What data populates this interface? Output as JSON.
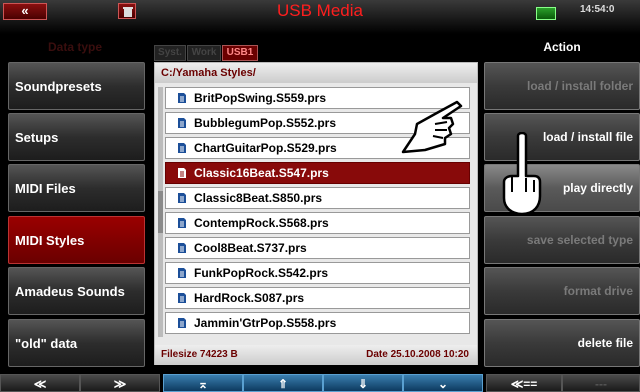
{
  "titlebar": {
    "back_label": "«",
    "title": "USB Media",
    "clock": "14:54:0"
  },
  "left": {
    "heading": "Data type",
    "items": [
      {
        "label": "Soundpresets",
        "active": false
      },
      {
        "label": "Setups",
        "active": false
      },
      {
        "label": "MIDI Files",
        "active": false
      },
      {
        "label": "MIDI Styles",
        "active": true
      },
      {
        "label": "Amadeus Sounds",
        "active": false
      },
      {
        "label": "\"old\" data",
        "active": false
      }
    ]
  },
  "tabs": [
    {
      "label": "Syst.",
      "active": false
    },
    {
      "label": "Work",
      "active": false
    },
    {
      "label": "USB1",
      "active": true
    }
  ],
  "browser": {
    "path": "C:/Yamaha Styles/",
    "files": [
      {
        "name": "BritPopSwing.S559.prs",
        "selected": false
      },
      {
        "name": "BubblegumPop.S552.prs",
        "selected": false
      },
      {
        "name": "ChartGuitarPop.S529.prs",
        "selected": false
      },
      {
        "name": "Classic16Beat.S547.prs",
        "selected": true
      },
      {
        "name": "Classic8Beat.S850.prs",
        "selected": false
      },
      {
        "name": "ContempRock.S568.prs",
        "selected": false
      },
      {
        "name": "Cool8Beat.S737.prs",
        "selected": false
      },
      {
        "name": "FunkPopRock.S542.prs",
        "selected": false
      },
      {
        "name": "HardRock.S087.prs",
        "selected": false
      },
      {
        "name": "Jammin'GtrPop.S558.prs",
        "selected": false
      }
    ],
    "filesize": "Filesize 74223 B",
    "date": "Date 25.10.2008  10:20"
  },
  "right": {
    "heading": "Action",
    "items": [
      {
        "label": "load  /  install folder",
        "enabled": false
      },
      {
        "label": "load  /  install file",
        "enabled": true
      },
      {
        "label": "play directly",
        "enabled": true
      },
      {
        "label": "save  selected  type",
        "enabled": false
      },
      {
        "label": "format  drive",
        "enabled": false
      },
      {
        "label": "delete  file",
        "enabled": true
      }
    ]
  },
  "bottom_nav": {
    "up_double": "≪",
    "down_double": "≫",
    "top": "⌅",
    "page_up": "⇑",
    "page_down": "⇓",
    "down": "⌄",
    "back": "≪==",
    "blank": "---"
  },
  "colors": {
    "accent_red": "#880a0a",
    "title_red": "#ff1e1e",
    "nav_blue": "#3a7fb0"
  }
}
